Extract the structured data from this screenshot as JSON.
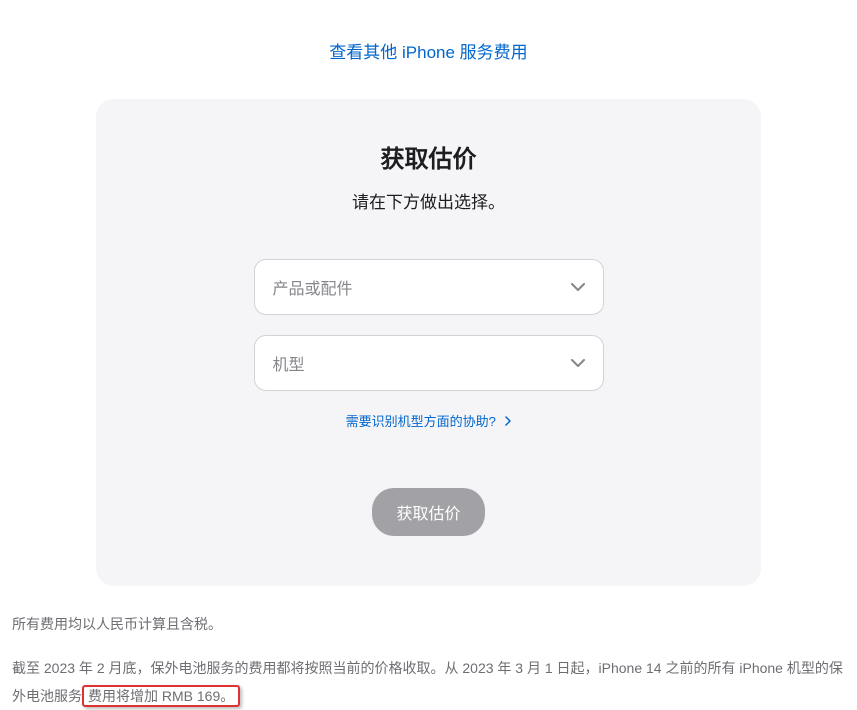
{
  "topLink": "查看其他 iPhone 服务费用",
  "card": {
    "title": "获取估价",
    "subtitle": "请在下方做出选择。",
    "select1": "产品或配件",
    "select2": "机型",
    "helpLink": "需要识别机型方面的协助?",
    "button": "获取估价"
  },
  "footer": {
    "line1": "所有费用均以人民币计算且含税。",
    "line2a": "截至 2023 年 2 月底，保外电池服务的费用都将按照当前的价格收取。从 2023 年 3 月 1 日起，iPhone 14 之前的所有 iPhone 机型的保外电池服务",
    "line2b": "费用将增加 RMB 169。"
  }
}
